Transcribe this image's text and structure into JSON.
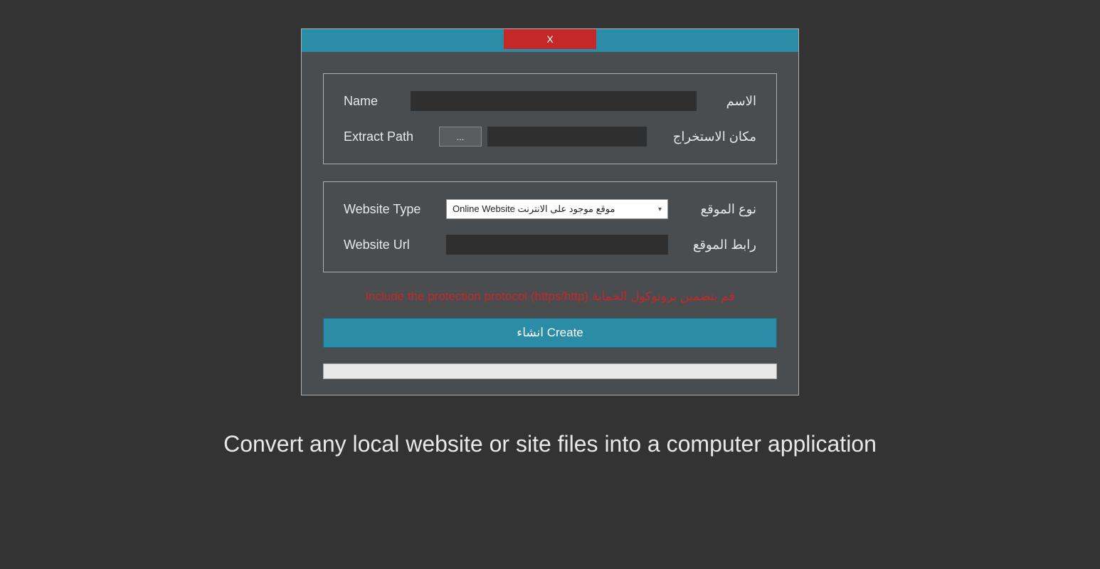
{
  "titlebar": {
    "close_label": "X"
  },
  "section1": {
    "name_label_en": "Name",
    "name_label_ar": "الاسم",
    "name_value": "",
    "extract_label_en": "Extract Path",
    "extract_label_ar": "مكان الاستخراج",
    "browse_label": "...",
    "extract_value": ""
  },
  "section2": {
    "type_label_en": "Website Type",
    "type_label_ar": "نوع الموقع",
    "type_selected": "Online Website موقع موجود على الانترنت",
    "url_label_en": "Website Url",
    "url_label_ar": "رابط الموقع",
    "url_value": ""
  },
  "warning_text": "Include the protection protocol (https/http) قم بتضمين بروتوكول الحماية",
  "create_button": "انشاء Create",
  "tagline": "Convert any local website or site files into a computer application"
}
